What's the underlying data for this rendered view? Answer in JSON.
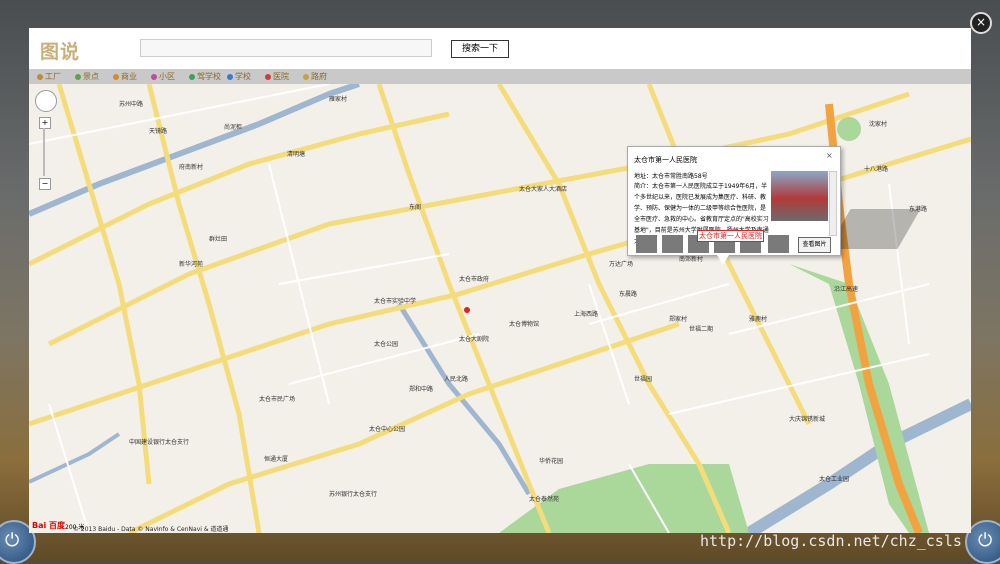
{
  "overlay": {
    "close_label": "×",
    "watermark": "http://blog.csdn.net/chz_csls"
  },
  "header": {
    "logo": "图说",
    "search_value": "",
    "search_button": "搜索一下"
  },
  "categories": [
    {
      "label": "工厂",
      "color": "#c08a3a"
    },
    {
      "label": "景点",
      "color": "#5ea34a"
    },
    {
      "label": "商业",
      "color": "#d68a2a"
    },
    {
      "label": "小区",
      "color": "#b94fa3"
    },
    {
      "label": "驾学校",
      "color": "#3aa05f"
    },
    {
      "label": "学校",
      "color": "#3a7ad0"
    },
    {
      "label": "医院",
      "color": "#d33a3a"
    },
    {
      "label": "路府",
      "color": "#c9a040"
    }
  ],
  "map": {
    "labels": [
      "雁家村",
      "尚泥柜",
      "苏州中路",
      "天镜路",
      "府南新村",
      "清明塘",
      "东阁",
      "太仓大家人大酒店",
      "太仓市第一人民医院",
      "群灶田",
      "新华河苑",
      "太仓市政府",
      "太仓市实验中学",
      "太仓博物馆",
      "太仓大剧院",
      "东城名府",
      "南郊新村",
      "太仓公园",
      "中国建设银行太仓支行",
      "苏州银行太仓支行",
      "恒通大厦",
      "华侨花园",
      "沈家村",
      "东港路",
      "十八港路",
      "沿江高速",
      "太仓工业园",
      "太仓泰然苑",
      "万达广场",
      "世福二期",
      "世福园",
      "郑家村",
      "大庆锦锈新城",
      "雅鹿村",
      "太仓市民广场",
      "太仓中心公园",
      "东晨路",
      "上海西路",
      "上海东路",
      "郑和中路",
      "人民北路"
    ],
    "scale": "200 米",
    "copyright": "© 2013 Baidu - Data © NavInfo & CenNavi & 道道通",
    "baidu_logo": "Bai 百度"
  },
  "popup": {
    "title": "太仓市第一人民医院",
    "close_label": "×",
    "address": "地址：太仓市常胜南路58号",
    "description": "简介：太仓市第一人民医院成立于1949年6月，半个多世纪以来，医院已发展成为集医疗、科研、教学、预防、保健为一体的二级甲等综合性医院，是全市医疗、急救的中心。省教育厅定点的\"高校实习基地\"，目前是苏州大学附属医院，扬州大学及南通大学",
    "view_button": "查看图片",
    "marker_label": "太仓市第一人民医院"
  }
}
